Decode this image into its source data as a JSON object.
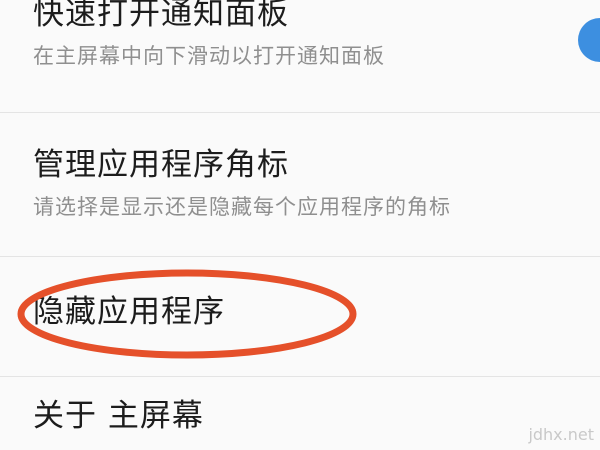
{
  "settings": {
    "items": [
      {
        "title": "快速打开通知面板",
        "subtitle": "在主屏幕中向下滑动以打开通知面板"
      },
      {
        "title": "管理应用程序角标",
        "subtitle": "请选择是显示还是隐藏每个应用程序的角标"
      },
      {
        "title": "隐藏应用程序"
      },
      {
        "title": "关于 主屏幕"
      }
    ]
  },
  "watermark": "jdhx.net",
  "colors": {
    "toggle": "#3d8fe0",
    "annotation_circle": "#e5502a",
    "title_text": "#1c1c1c",
    "subtitle_text": "#8f8f8f"
  }
}
